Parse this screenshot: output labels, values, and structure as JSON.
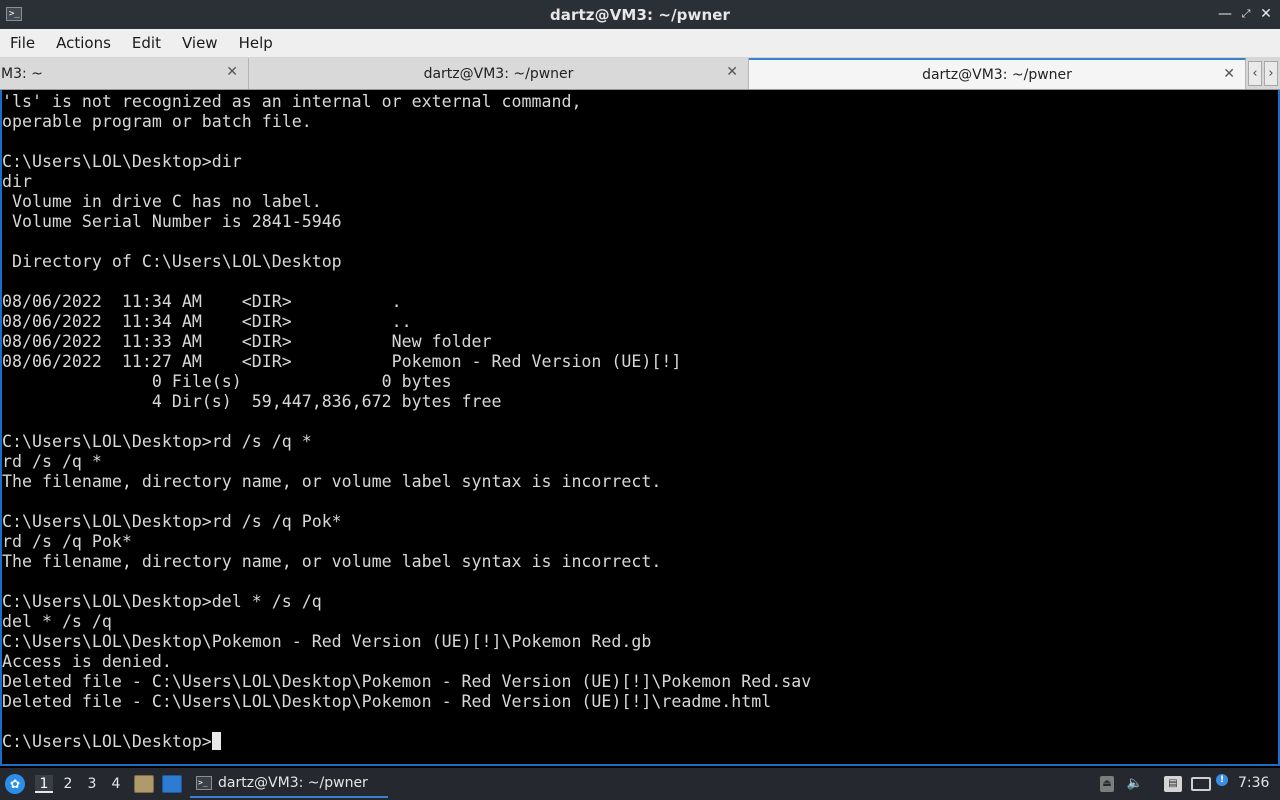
{
  "window": {
    "title": "dartz@VM3: ~/pwner",
    "icon": "terminal-icon",
    "controls": [
      "minimize-icon",
      "maximize-icon",
      "close-icon"
    ]
  },
  "menu": {
    "items": [
      "File",
      "Actions",
      "Edit",
      "View",
      "Help"
    ]
  },
  "tabs": [
    {
      "label": "M3: ~"
    },
    {
      "label": "dartz@VM3: ~/pwner"
    },
    {
      "label": "dartz@VM3: ~/pwner",
      "active": true
    }
  ],
  "terminal": {
    "lines": [
      "'ls' is not recognized as an internal or external command,",
      "operable program or batch file.",
      "",
      "C:\\Users\\LOL\\Desktop>dir",
      "dir",
      " Volume in drive C has no label.",
      " Volume Serial Number is 2841-5946",
      "",
      " Directory of C:\\Users\\LOL\\Desktop",
      "",
      "08/06/2022  11:34 AM    <DIR>          .",
      "08/06/2022  11:34 AM    <DIR>          ..",
      "08/06/2022  11:33 AM    <DIR>          New folder",
      "08/06/2022  11:27 AM    <DIR>          Pokemon - Red Version (UE)[!]",
      "               0 File(s)              0 bytes",
      "               4 Dir(s)  59,447,836,672 bytes free",
      "",
      "C:\\Users\\LOL\\Desktop>rd /s /q *",
      "rd /s /q *",
      "The filename, directory name, or volume label syntax is incorrect.",
      "",
      "C:\\Users\\LOL\\Desktop>rd /s /q Pok*",
      "rd /s /q Pok*",
      "The filename, directory name, or volume label syntax is incorrect.",
      "",
      "C:\\Users\\LOL\\Desktop>del * /s /q",
      "del * /s /q",
      "C:\\Users\\LOL\\Desktop\\Pokemon - Red Version (UE)[!]\\Pokemon Red.gb",
      "Access is denied.",
      "Deleted file - C:\\Users\\LOL\\Desktop\\Pokemon - Red Version (UE)[!]\\Pokemon Red.sav",
      "Deleted file - C:\\Users\\LOL\\Desktop\\Pokemon - Red Version (UE)[!]\\readme.html",
      ""
    ],
    "prompt": "C:\\Users\\LOL\\Desktop>"
  },
  "panel": {
    "workspaces": [
      "1",
      "2",
      "3",
      "4"
    ],
    "active_workspace": "1",
    "task_label": "dartz@VM3: ~/pwner",
    "clock": "7:36",
    "colors": {
      "accent": "#3a7fd0",
      "panel_bg": "#25292f",
      "terminal_border": "#1c6dc7"
    }
  }
}
